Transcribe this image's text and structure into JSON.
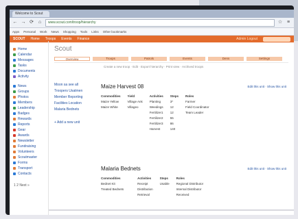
{
  "browser": {
    "tab_title": "Welcome to Scout",
    "url": "www.scout.com/troop/hierarchy",
    "bookmarks": [
      "Apps",
      "Personal",
      "Work",
      "News",
      "Shopping",
      "Tools",
      "Links",
      "Other bookmarks"
    ]
  },
  "appbar": {
    "brand": "SCOUT",
    "items": [
      "Home",
      "Troops",
      "Events",
      "Finance"
    ],
    "user": "Admin  Logout"
  },
  "sidebar": {
    "groups": [
      [
        {
          "label": "Home",
          "color": "#e07b39"
        },
        {
          "label": "Calendar",
          "color": "#3b9b4a"
        },
        {
          "label": "Messages",
          "color": "#2c7ad6"
        },
        {
          "label": "Tasks",
          "color": "#3b9b4a"
        },
        {
          "label": "Documents",
          "color": "#2c7ad6"
        },
        {
          "label": "Activity",
          "color": "#7a5cc7"
        }
      ],
      [
        {
          "label": "News",
          "color": "#2c7ad6"
        },
        {
          "label": "Groups",
          "color": "#3b9b4a"
        },
        {
          "label": "Photos",
          "color": "#e07b39"
        },
        {
          "label": "Members",
          "color": "#2c7ad6"
        },
        {
          "label": "Leadership",
          "color": "#3b9b4a"
        },
        {
          "label": "Badges",
          "color": "#2c7ad6"
        },
        {
          "label": "Rewards",
          "color": "#e07b39"
        },
        {
          "label": "Reports",
          "color": "#2c7ad6"
        },
        {
          "label": "Gear",
          "color": "#d6392c"
        },
        {
          "label": "Awards",
          "color": "#d6392c"
        },
        {
          "label": "Newsletter",
          "color": "#e07b39"
        },
        {
          "label": "Fundraising",
          "color": "#e07b39"
        },
        {
          "label": "Volunteers",
          "color": "#e07b39"
        },
        {
          "label": "Scoutmaster",
          "color": "#e07b39"
        },
        {
          "label": "Forms",
          "color": "#2c7ad6"
        },
        {
          "label": "Transport",
          "color": "#e07b39"
        },
        {
          "label": "Contacts",
          "color": "#2c7ad6"
        }
      ]
    ],
    "pager": "1  2  Next »"
  },
  "page": {
    "title": "Scout",
    "tabs": [
      "Overview",
      "Troops",
      "Patrols",
      "Events",
      "Dens",
      "Settings"
    ],
    "subnav": "Create a new troop  ·  Edit  ·  Export hierarchy  ·  Print view  ·  Archived troops"
  },
  "leftnav": {
    "items": [
      "Moon sa see all",
      "Troopers Usatmen",
      "Member Reporting",
      "Facilities Location",
      "Malaria Bednets"
    ],
    "new_category": "+ Add a new unit"
  },
  "troops": [
    {
      "name": "Maize Harvest 08",
      "links": "Edit this unit  ·  Show this unit",
      "columns": [
        {
          "rows": [
            "Commodities",
            "Maize Yellow",
            "Maize White"
          ]
        },
        {
          "rows": [
            "Yield",
            "Village Ank",
            "Villageo"
          ]
        },
        {
          "rows": [
            "Activities",
            "Planting",
            "Weedings",
            "Fertilizer1",
            "Fertilizer2",
            "Fertilizer3",
            "Harvest"
          ]
        },
        {
          "rows": [
            "Steps",
            "3*",
            "12",
            "12",
            "55",
            "86",
            "140"
          ]
        },
        {
          "rows": [
            "Roles",
            "Farmer",
            "Field Coordinator",
            "Team Leader"
          ]
        }
      ]
    },
    {
      "name": "Malaria Bednets",
      "links": "Edit this unit  ·  Show this unit",
      "columns": [
        {
          "rows": [
            "Commodities",
            "Bednet Kit",
            "Treated Bednets"
          ]
        },
        {
          "rows": [
            ""
          ]
        },
        {
          "rows": [
            "Activities",
            "Receipt",
            "Distribution",
            "Retrieval"
          ]
        },
        {
          "rows": [
            "Steps",
            "",
            "",
            "Usable"
          ]
        },
        {
          "rows": [
            "Roles",
            "Regional Distributor",
            "Internal Distributor",
            "Received"
          ]
        }
      ]
    }
  ]
}
